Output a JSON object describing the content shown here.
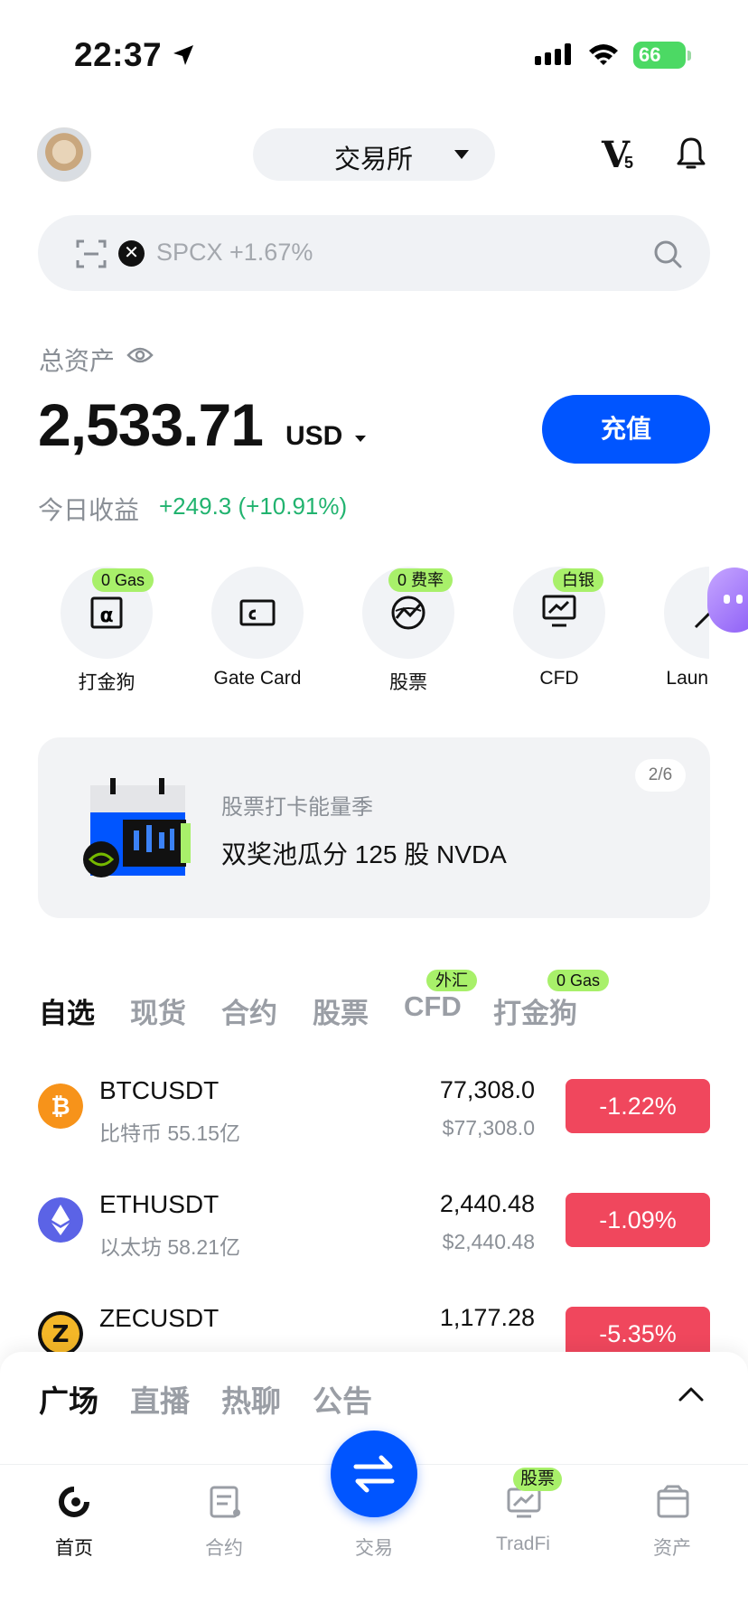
{
  "status_bar": {
    "time": "22:37",
    "battery": "66"
  },
  "header": {
    "exchange_label": "交易所",
    "vip_label": "V",
    "vip_level": "5"
  },
  "search": {
    "ticker_symbol": "✕",
    "placeholder": "SPCX +1.67%"
  },
  "assets": {
    "label": "总资产",
    "balance": "2,533.71",
    "currency": "USD",
    "deposit_label": "充值",
    "today_label": "今日收益",
    "today_value": "+249.3 (+10.91%)"
  },
  "quick_actions": [
    {
      "label": "打金狗",
      "badge": "0 Gas",
      "icon": "alpha-icon"
    },
    {
      "label": "Gate Card",
      "badge": "",
      "icon": "card-icon"
    },
    {
      "label": "股票",
      "badge": "0 费率",
      "icon": "globe-chart-icon"
    },
    {
      "label": "CFD",
      "badge": "白银",
      "icon": "monitor-chart-icon"
    },
    {
      "label": "Launc",
      "badge": "",
      "icon": "launch-icon"
    }
  ],
  "banner": {
    "pager": "2/6",
    "subtitle": "股票打卡能量季",
    "title": "双奖池瓜分 125 股 NVDA"
  },
  "market_tabs": [
    {
      "label": "自选",
      "badge": ""
    },
    {
      "label": "现货",
      "badge": ""
    },
    {
      "label": "合约",
      "badge": ""
    },
    {
      "label": "股票",
      "badge": ""
    },
    {
      "label": "CFD",
      "badge": "外汇"
    },
    {
      "label": "打金狗",
      "badge": "0 Gas"
    }
  ],
  "market_rows": [
    {
      "pair": "BTCUSDT",
      "sub": "比特币 55.15亿",
      "price": "77,308.0",
      "price_usd": "$77,308.0",
      "change": "-1.22%",
      "icon": "btc-icon",
      "color": "#f7931a"
    },
    {
      "pair": "ETHUSDT",
      "sub": "以太坊 58.21亿",
      "price": "2,440.48",
      "price_usd": "$2,440.48",
      "change": "-1.09%",
      "icon": "eth-icon",
      "color": "#5b63e6"
    },
    {
      "pair": "ZECUSDT",
      "sub": "",
      "price": "1,177.28",
      "price_usd": "",
      "change": "-5.35%",
      "icon": "zec-icon",
      "color": "#f4b728"
    }
  ],
  "sheet_tabs": [
    "广场",
    "直播",
    "热聊",
    "公告"
  ],
  "bottom_nav": [
    {
      "label": "首页",
      "active": true
    },
    {
      "label": "合约",
      "active": false
    },
    {
      "label": "交易",
      "active": false
    },
    {
      "label": "TradFi",
      "active": false,
      "badge": "股票"
    },
    {
      "label": "资产",
      "active": false
    }
  ],
  "colors": {
    "accent": "#0055ff",
    "up": "#21b36f",
    "down": "#f0475d",
    "badge": "#a8f06a"
  }
}
